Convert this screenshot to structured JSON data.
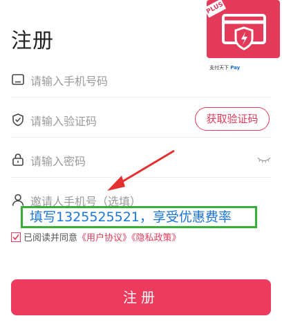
{
  "page": {
    "title": "注册"
  },
  "form": {
    "phone_placeholder": "请输入手机号码",
    "code_placeholder": "请输入验证码",
    "get_code_label": "获取验证码",
    "password_placeholder": "请输入密码",
    "inviter_placeholder": "邀请人手机号（选填）"
  },
  "annotation": {
    "promo_text": "填写1325525521，享受优惠费率"
  },
  "agreement": {
    "prefix": "已阅读并同意",
    "user_agreement": "《用户协议》",
    "privacy_policy": "《隐私政策》"
  },
  "submit_label": "注册",
  "banner": {
    "badge": "PLUS",
    "caption_a": "支付天下",
    "caption_b": "Pay"
  },
  "colors": {
    "accent": "#ec3b5c",
    "promo_border": "#35b035",
    "promo_text": "#1a75d6"
  }
}
